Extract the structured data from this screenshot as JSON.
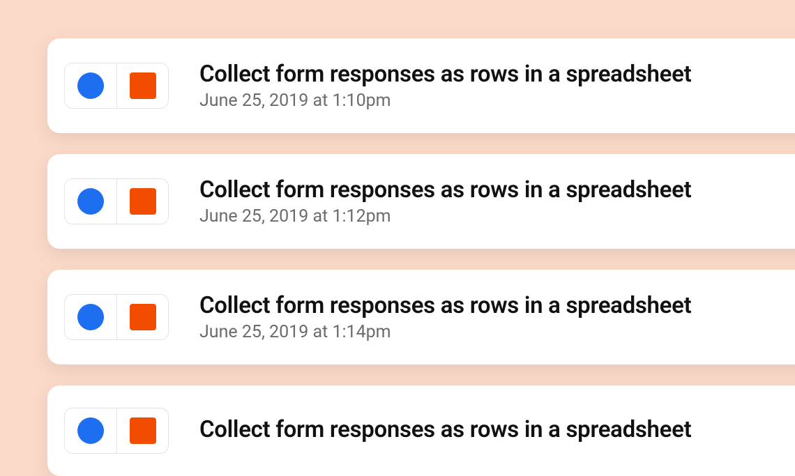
{
  "colors": {
    "circle": "#1d6ef0",
    "square": "#f24c00",
    "background": "#fbd9c9"
  },
  "cards": [
    {
      "title": "Collect form responses as rows in a spreadsheet",
      "timestamp": "June 25, 2019 at 1:10pm"
    },
    {
      "title": "Collect form responses as rows in a spreadsheet",
      "timestamp": "June 25, 2019 at 1:12pm"
    },
    {
      "title": "Collect form responses as rows in a spreadsheet",
      "timestamp": "June 25, 2019 at 1:14pm"
    },
    {
      "title": "Collect form responses as rows in a spreadsheet",
      "timestamp": ""
    }
  ]
}
